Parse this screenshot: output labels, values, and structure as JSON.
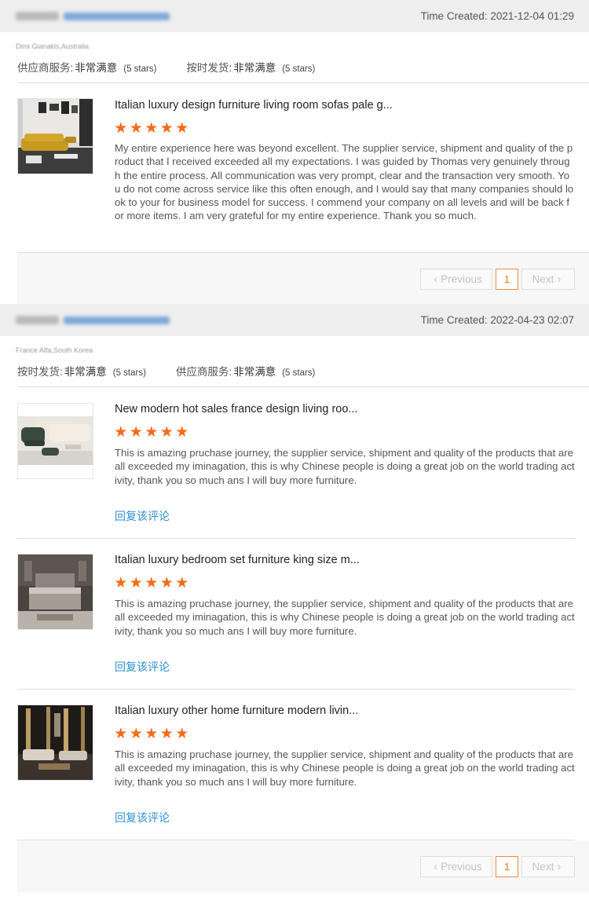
{
  "orders": [
    {
      "time_created": "Time Created: 2021-12-04 01:29",
      "buyer": "Dimi Gianakis,Australia",
      "ratings": [
        {
          "label": "供应商服务:",
          "value": "非常满意",
          "stars": "(5 stars)"
        },
        {
          "label": "按时发货:",
          "value": "非常满意",
          "stars": "(5 stars)"
        }
      ],
      "reviews": [
        {
          "title": "Italian luxury design furniture living room sofas pale g...",
          "stars": 5,
          "text": "My entire experience here was beyond excellent. The supplier service, shipment and quality of the product that I received exceeded all my expectations. I was guided by Thomas very genuinely through the entire process. All communication was very prompt, clear and the transaction very smooth. You do not come across service like this often enough, and I would say that many companies should look to your for business model for success. I commend your company on all levels and will be back for more items. I am very grateful for my entire experience. Thank you so much."
        }
      ],
      "pager": {
        "prev": "Previous",
        "page": "1",
        "next": "Next"
      }
    },
    {
      "time_created": "Time Created: 2022-04-23 02:07",
      "buyer": "France Alfa,South Korea",
      "ratings": [
        {
          "label": "按时发货:",
          "value": "非常满意",
          "stars": "(5 stars)"
        },
        {
          "label": "供应商服务:",
          "value": "非常满意",
          "stars": "(5 stars)"
        }
      ],
      "reviews": [
        {
          "title": "New modern hot sales france design living roo...",
          "stars": 5,
          "text": "This is amazing pruchase journey, the supplier service, shipment and  quality of the products that are all exceeded my iminagation, this is why Chinese people is doing a great job on the world trading activity, thank you so much ans I will buy more furniture.",
          "reply": "回复该评论"
        },
        {
          "title": "Italian luxury bedroom set furniture king size m...",
          "stars": 5,
          "text": "This is amazing pruchase journey, the supplier service, shipment and  quality of the products that are all exceeded my iminagation, this is why Chinese people is doing a great job on the world trading activity, thank you so much ans I will buy more furniture.",
          "reply": "回复该评论"
        },
        {
          "title": "Italian luxury other home furniture modern livin...",
          "stars": 5,
          "text": "This is amazing pruchase journey, the supplier service, shipment and  quality of the products that are all exceeded my iminagation, this is why Chinese people is doing a great job on the world trading activity, thank you so much ans I will buy more furniture.",
          "reply": "回复该评论"
        }
      ],
      "pager": {
        "prev": "Previous",
        "page": "1",
        "next": "Next"
      }
    }
  ],
  "colors": {
    "star": "#f46b18",
    "link": "#2d8fd5",
    "accent": "#e8751a"
  }
}
